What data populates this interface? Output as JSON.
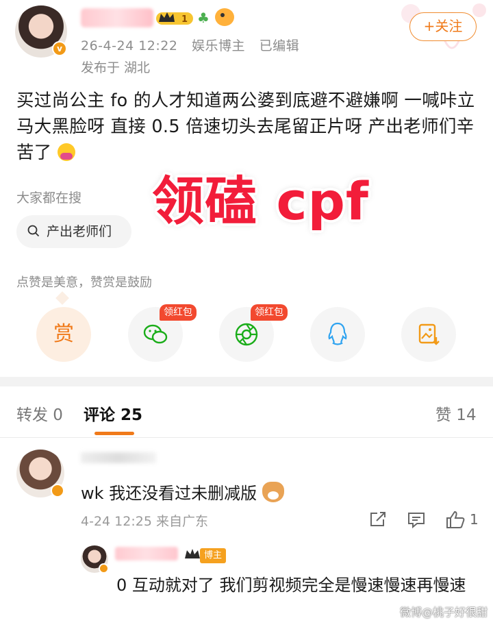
{
  "post": {
    "author_badge_level": "1",
    "timestamp": "26-4-24 12:22",
    "author_category": "娱乐博主",
    "edited": "已编辑",
    "location": "发布于 湖北",
    "follow_label": "+关注",
    "text": "买过尚公主 fo 的人才知道两公婆到底避不避嫌啊 一喊咔立马大黑脸呀  直接 0.5 倍速切头去尾留正片呀  产出老师们辛苦了",
    "overlay_text": "领磕 cpf"
  },
  "search": {
    "label": "大家都在搜",
    "chip": "产出老师们"
  },
  "reward": {
    "hint": "点赞是美意，赞赏是鼓励",
    "reward_label": "赏",
    "red_packet_label": "领红包"
  },
  "tabs": {
    "repost": "转发 0",
    "comments": "评论 25",
    "likes": "赞 14"
  },
  "comment": {
    "text": "wk 我还没看过未删减版",
    "meta": "4-24 12:25  来自广东",
    "like_count": "1"
  },
  "reply": {
    "tag": "博主",
    "text": "0 互动就对了 我们剪视频完全是慢速慢速再慢速"
  },
  "watermark": "微博@桃子好很甜",
  "colors": {
    "accent": "#f07a1a",
    "red_packet": "#f2492f",
    "overlay_red": "#f21d3a"
  }
}
